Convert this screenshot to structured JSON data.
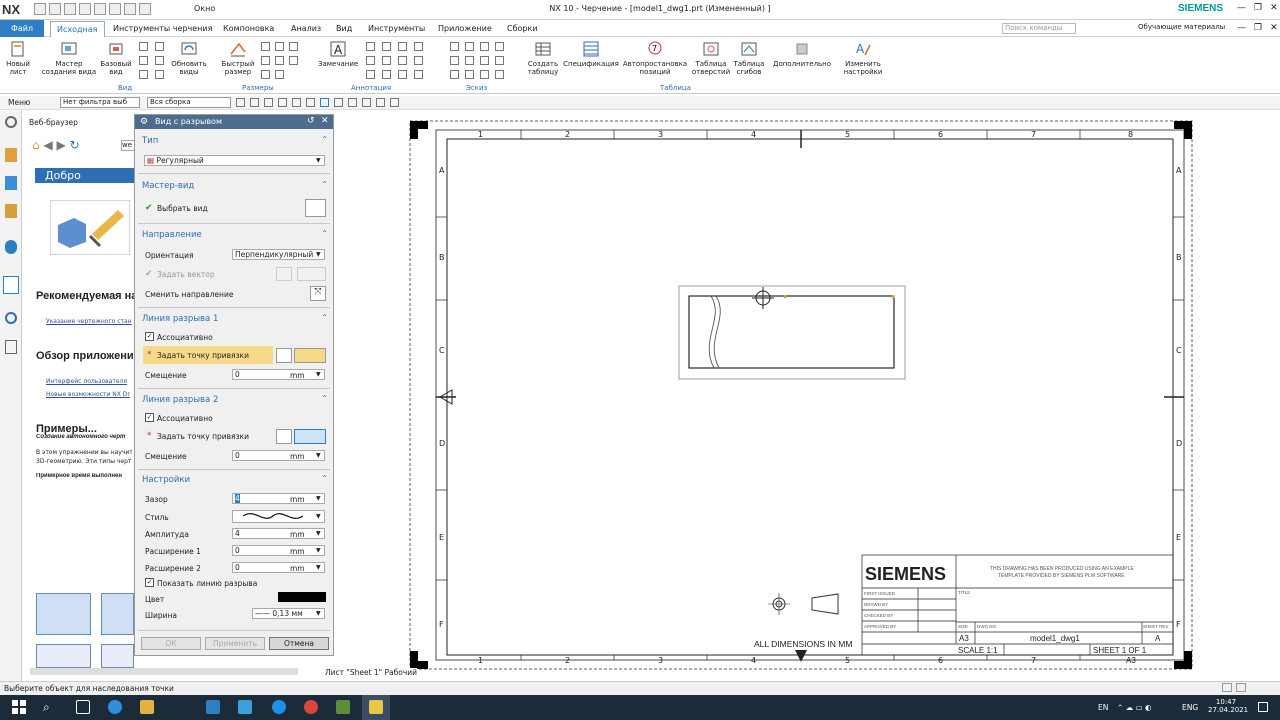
{
  "titlebar": {
    "logo": "NX",
    "window_menu": "Окно",
    "title": "NX 10 - Черчение - [model1_dwg1.prt (Измененный) ]",
    "brand": "SIEMENS"
  },
  "menu": {
    "file": "Файл",
    "tabs": [
      "Исходная",
      "Инструменты черчения",
      "Компоновка",
      "Анализ",
      "Вид",
      "Инструменты",
      "Приложение",
      "Сборки"
    ],
    "search_placeholder": "Поиск команды",
    "learning": "Обучающие материалы"
  },
  "ribbon": {
    "buttons": [
      "Новый лист",
      "Мастер создания вида",
      "Базовый вид",
      "Обновить виды",
      "Быстрый размер",
      "Замечание",
      "Создать таблицу",
      "Спецификация",
      "Автопростановка позиций",
      "Таблица отверстий",
      "Таблица сгибов",
      "Дополнительно",
      "Изменить настройки"
    ],
    "groups": {
      "view": "Вид",
      "dims": "Размеры",
      "annot": "Аннотация",
      "sketch": "Эскиз",
      "table": "Таблица"
    }
  },
  "toolbar2": {
    "menu": "Меню",
    "filter": "Нет фильтра выб",
    "assembly": "Вся сборка"
  },
  "webpanel": {
    "title": "Веб-браузер",
    "url": "we",
    "banner": "Добро пожалов",
    "h_recommended": "Рекомендуемая на",
    "link1": "Указание чертежного стан",
    "h_overview": "Обзор приложени",
    "link2": "Интерфейс пользователя",
    "link3": "Новые возможности NX Dr",
    "h_examples": "Примеры...",
    "sub_examples": "Создание автономного черт",
    "p1": "В этом упражнении вы научит",
    "p2": "3D-геометрию. Эти типы черт",
    "p3": "Примерное время выполнен"
  },
  "dialog": {
    "title": "Вид с разрывом",
    "type_section": "Тип",
    "type_value": "Регулярный",
    "master_section": "Мастер-вид",
    "select_view": "Выбрать вид",
    "direction_section": "Направление",
    "orientation_label": "Ориентация",
    "orientation_value": "Перпендикулярный",
    "vector_label": "Задать вектор",
    "reverse_label": "Сменить направление",
    "break1_section": "Линия разрыва 1",
    "assoc1": "Ассоциативно",
    "point1": "Задать точку привязки",
    "offset1_label": "Смещение",
    "offset1_value": "0",
    "unit": "mm",
    "break2_section": "Линия разрыва 2",
    "assoc2": "Ассоциативно",
    "point2": "Задать точку привязки",
    "offset2_label": "Смещение",
    "offset2_value": "0",
    "settings_section": "Настройки",
    "gap_label": "Зазор",
    "gap_value": "4",
    "style_label": "Стиль",
    "amp_label": "Амплитуда",
    "amp_value": "4",
    "ext1_label": "Расширение 1",
    "ext1_value": "0",
    "ext2_label": "Расширение 2",
    "ext2_value": "0",
    "show_line": "Показать линию разрыва",
    "color_label": "Цвет",
    "width_label": "Ширина",
    "width_value": "0,13 мм",
    "ok": "ОК",
    "apply": "Применить",
    "cancel": "Отмена"
  },
  "drawing": {
    "col_labels": [
      "1",
      "2",
      "3",
      "4",
      "5",
      "6",
      "7",
      "8"
    ],
    "row_labels": [
      "A",
      "B",
      "C",
      "D",
      "E",
      "F"
    ],
    "dims_note": "ALL DIMENSIONS IN MM",
    "tb_brand": "SIEMENS",
    "tb_note1": "THIS DRAWING HAS BEEN PRODUCED USING AN EXAMPLE",
    "tb_note2": "TEMPLATE PROVIDED BY SIEMENS PLM SOFTWARE",
    "tb_first": "FIRST ISSUED",
    "tb_drawn": "DRAWN BY",
    "tb_checked": "CHECKED BY",
    "tb_approved": "APPROVED BY",
    "tb_title": "TITLE",
    "tb_size": "SIZE",
    "tb_dwgno": "DWG NO",
    "tb_rev": "SHEET REV",
    "tb_size_val": "A3",
    "tb_dwg_val": "model1_dwg1",
    "tb_rev_val": "A",
    "tb_scale": "SCALE 1:1",
    "tb_sheet": "SHEET 1 OF 1",
    "tb_a3": "A3",
    "sheet_tab": "Лист \"Sheet 1\" Рабочий"
  },
  "status": {
    "text": "Выберите объект для наследования точки"
  },
  "taskbar": {
    "lang1": "EN",
    "lang2": "ENG",
    "time": "10:47",
    "date": "27.04.2021"
  },
  "colors": {
    "accent": "#2e7ec3",
    "dialog_title": "#4e6c8c",
    "highlight": "#f7d98a",
    "taskbar": "#1c2b3a"
  }
}
